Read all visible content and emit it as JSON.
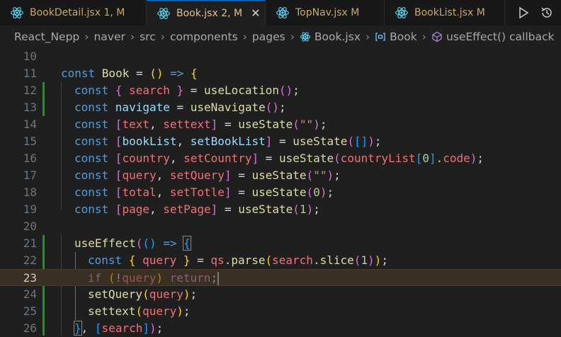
{
  "tabs": [
    {
      "name": "BookDetail.jsx",
      "status": "1, M",
      "active": false
    },
    {
      "name": "Book.jsx",
      "status": "2, M",
      "active": true,
      "close": "✕"
    },
    {
      "name": "TopNav.jsx",
      "status": "M",
      "active": false
    },
    {
      "name": "BookList.jsx",
      "status": "M",
      "active": false
    }
  ],
  "breadcrumb": [
    "React_Nepp",
    "naver",
    "src",
    "components",
    "pages",
    "Book.jsx",
    "Book",
    "useEffect() callback"
  ],
  "actions": [
    "run-icon",
    "history-icon"
  ],
  "line_numbers": [
    "10",
    "11",
    "12",
    "13",
    "14",
    "15",
    "16",
    "17",
    "18",
    "19",
    "20",
    "21",
    "22",
    "23",
    "24",
    "25",
    "26"
  ],
  "code": {
    "l11": [
      "const ",
      "Book",
      " = ",
      "()",
      " => ",
      "{"
    ],
    "l12": [
      "const ",
      "{",
      " search ",
      "}",
      " = ",
      "useLocation",
      "()",
      ";"
    ],
    "l13": [
      "const ",
      "navigate",
      " = ",
      "useNavigate",
      "()",
      ";"
    ],
    "l14": [
      "const ",
      "[",
      "text",
      ", ",
      "settext",
      "]",
      " = ",
      "useState",
      "(",
      "\"\"",
      ")",
      ";"
    ],
    "l15": [
      "const ",
      "[",
      "bookList",
      ", ",
      "setBookList",
      "]",
      " = ",
      "useState",
      "(",
      "[]",
      ")",
      ";"
    ],
    "l16": [
      "const ",
      "[",
      "country",
      ", ",
      "setCountry",
      "]",
      " = ",
      "useState",
      "(",
      "countryList",
      "[",
      "0",
      "]",
      ".",
      "code",
      ")",
      ";"
    ],
    "l17": [
      "const ",
      "[",
      "query",
      ", ",
      "setQuery",
      "]",
      " = ",
      "useState",
      "(",
      "\"\"",
      ")",
      ";"
    ],
    "l18": [
      "const ",
      "[",
      "total",
      ", ",
      "setTotle",
      "]",
      " = ",
      "useState",
      "(",
      "0",
      ")",
      ";"
    ],
    "l19": [
      "const ",
      "[",
      "page",
      ", ",
      "setPage",
      "]",
      " = ",
      "useState",
      "(",
      "1",
      ")",
      ";"
    ],
    "l21": [
      "useEffect",
      "(",
      "()",
      " => ",
      "{"
    ],
    "l22": [
      "const ",
      "{",
      " query ",
      "}",
      " = ",
      "qs",
      ".",
      "parse",
      "(",
      "search",
      ".",
      "slice",
      "(",
      "1",
      ")",
      ")",
      ";"
    ],
    "l23": [
      "if ",
      "(",
      "!",
      "query",
      ")",
      " return",
      ";"
    ],
    "l24": [
      "setQuery",
      "(",
      "query",
      ")",
      ";"
    ],
    "l25": [
      "settext",
      "(",
      "query",
      ")",
      ";"
    ],
    "l26": [
      "}",
      ", ",
      "[",
      "search",
      "]",
      ")",
      ";"
    ]
  },
  "colors": {
    "accent": "#0078d4",
    "modified": "#e2c08d",
    "current_line": "#3a2f23",
    "git_modified": "#3e7b3e"
  }
}
